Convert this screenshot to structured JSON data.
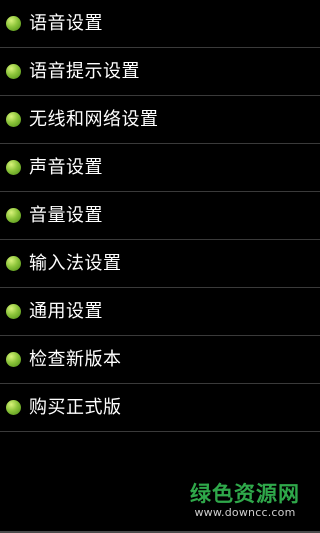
{
  "menu": {
    "items": [
      {
        "label": "语音设置",
        "icon": "green-dot-icon"
      },
      {
        "label": "语音提示设置",
        "icon": "green-dot-icon"
      },
      {
        "label": "无线和网络设置",
        "icon": "green-dot-icon"
      },
      {
        "label": "声音设置",
        "icon": "green-dot-icon"
      },
      {
        "label": "音量设置",
        "icon": "green-dot-icon"
      },
      {
        "label": "输入法设置",
        "icon": "green-dot-icon"
      },
      {
        "label": "通用设置",
        "icon": "green-dot-icon"
      },
      {
        "label": "检查新版本",
        "icon": "green-dot-icon"
      },
      {
        "label": "购买正式版",
        "icon": "green-dot-icon"
      }
    ]
  },
  "watermark": {
    "title": "绿色资源网",
    "url": "www.downcc.com"
  },
  "colors": {
    "background": "#000000",
    "text": "#ffffff",
    "divider": "#3a3a3a",
    "bullet": "#8cc43a",
    "watermark": "#2fa84a"
  }
}
